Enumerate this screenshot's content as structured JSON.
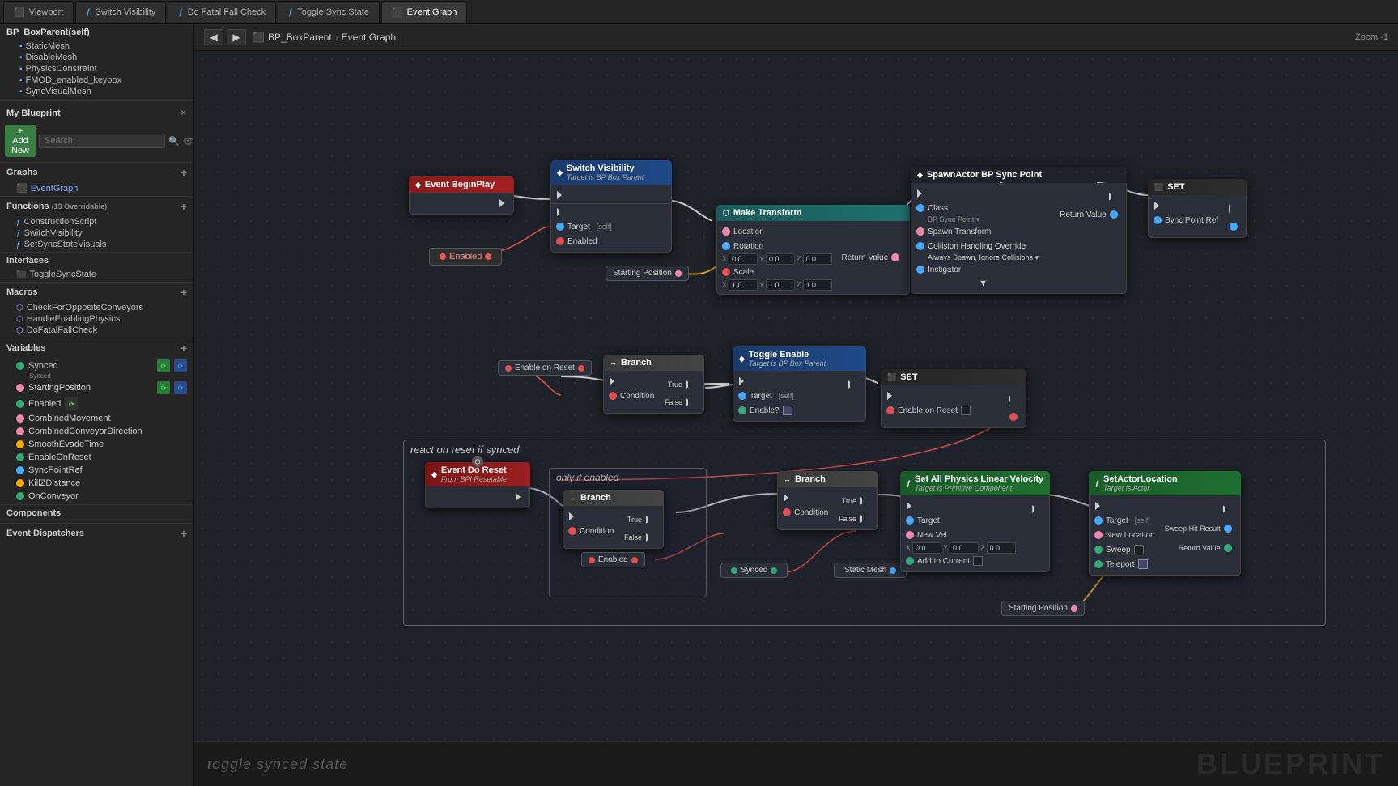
{
  "tabs": [
    {
      "label": "Viewport",
      "icon": "vp",
      "active": false,
      "color": "#4a8"
    },
    {
      "label": "Switch Visibility",
      "icon": "f",
      "active": false,
      "color": "#4af"
    },
    {
      "label": "Do Fatal Fall Check",
      "icon": "f",
      "active": false,
      "color": "#4af"
    },
    {
      "label": "Toggle Sync State",
      "icon": "f",
      "active": false,
      "color": "#4af"
    },
    {
      "label": "Event Graph",
      "icon": "eg",
      "active": true,
      "color": "#7af"
    }
  ],
  "breadcrumb": {
    "parent": "BP_BoxParent",
    "child": "Event Graph"
  },
  "zoom": "Zoom -1",
  "sidebar": {
    "header": "BP_BoxParent(self)",
    "top_items": [
      {
        "icon": "▪",
        "label": "StaticMesh"
      },
      {
        "icon": "▪",
        "label": "DisableMesh"
      },
      {
        "icon": "▪",
        "label": "PhysicsConstraint"
      },
      {
        "icon": "▪",
        "label": "FMOD_enabled_keybox"
      },
      {
        "icon": "▪",
        "label": "SyncVisualMesh"
      }
    ],
    "my_blueprint": "My Blueprint",
    "add_new": "+ Add New",
    "search_placeholder": "Search",
    "sections": {
      "graphs": {
        "label": "Graphs",
        "count": null
      },
      "graphs_items": [
        "EventGraph"
      ],
      "functions": {
        "label": "Functions",
        "count": "(19 Overridable)"
      },
      "functions_items": [
        "ConstructionScript",
        "SwitchVisibility",
        "SetSyncStateVisuals"
      ],
      "interfaces": {
        "label": "Interfaces"
      },
      "interfaces_items": [
        "ToggleSyncState"
      ],
      "macros": {
        "label": "Macros"
      },
      "macros_items": [
        "CheckForOppositeConveyors",
        "HandleEnablingPhysics",
        "DoFatalFallCheck"
      ],
      "variables": {
        "label": "Variables"
      },
      "variables_items": [
        {
          "name": "Synced",
          "color": "#3a7",
          "synced": true
        },
        {
          "name": "StartingPosition",
          "color": "#e8a",
          "synced": true
        },
        {
          "name": "Enabled",
          "color": "#3a7",
          "synced": false
        },
        {
          "name": "CombinedMovement",
          "color": "#e8a",
          "synced": false
        },
        {
          "name": "CombinedConveyorDirection",
          "color": "#e8a",
          "synced": false
        },
        {
          "name": "SmoothEvadeTime",
          "color": "#fa0",
          "synced": false
        },
        {
          "name": "EnableOnReset",
          "color": "#3a7",
          "synced": false
        },
        {
          "name": "SyncPointRef",
          "color": "#4af",
          "synced": false
        },
        {
          "name": "KillZDistance",
          "color": "#fa0",
          "synced": false
        },
        {
          "name": "OnConveyor",
          "color": "#3a7",
          "synced": false
        }
      ],
      "components": {
        "label": "Components"
      },
      "event_dispatchers": {
        "label": "Event Dispatchers"
      }
    }
  },
  "nodes": {
    "event_begin_play": "Event BeginPlay",
    "switch_visibility": "Switch Visibility",
    "switch_vis_target": "Target is BP Box Parent",
    "make_transform": "Make Transform",
    "location": "Location",
    "rotation": "Rotation",
    "scale": "Scale",
    "return_value": "Return Value",
    "spawn_actor": "SpawnActor BP Sync Point",
    "class": "Class",
    "spawn_transform": "Spawn Transform",
    "collision_handling": "Collision Handling Override",
    "always_spawn": "Always Spawn, Ignore Collisions ▾",
    "instigator": "Instigator",
    "set": "SET",
    "sync_point_ref": "Sync Point Ref",
    "enabled_label": "Enabled",
    "starting_position": "Starting Position",
    "enable_on_reset": "Enable on Reset",
    "branch": "Branch",
    "condition": "Condition",
    "true_label": "True",
    "false_label": "False",
    "toggle_enable": "Toggle Enable",
    "toggle_enable_target": "Target is BP Box Parent",
    "target_self": "self",
    "enable_question": "Enable?",
    "set2": "SET",
    "enable_on_reset2": "Enable on Reset",
    "comment1": "react on reset if synced",
    "comment2": "only if enabled",
    "event_do_reset": "Event Do Reset",
    "from_bpi": "From BPI Resetable",
    "branch2": "Branch",
    "condition2": "Condition",
    "true2": "True",
    "false2": "False",
    "enabled2": "Enabled",
    "branch3": "Branch",
    "condition3": "Condition",
    "true3": "True",
    "false3": "False",
    "synced_node": "Synced",
    "static_mesh": "Static Mesh",
    "set_physics": "Set All Physics Linear Velocity",
    "physics_target": "Target is Primitive Component",
    "new_vel": "New Vel",
    "add_to_current": "Add to Current",
    "set_actor_location": "SetActorLocation",
    "actor_target": "Target is Actor",
    "target2": "Target",
    "sweep_hit": "Sweep Hit Result",
    "new_location": "New Location",
    "sweep": "Sweep",
    "teleport": "Teleport",
    "return_value2": "Return Value",
    "starting_position2": "Starting Position",
    "bottom_label": "toggle synced state",
    "blueprint_watermark": "BLUEPRINT"
  },
  "colors": {
    "exec_white": "#cccccc",
    "pin_red": "#e05050",
    "pin_blue": "#5090e0",
    "pin_green": "#50e050",
    "pin_orange": "#e08030",
    "pin_yellow": "#e0e050",
    "pin_purple": "#a050e0",
    "pin_teal": "#50d0d0",
    "header_event": "#8B1A1A",
    "header_func": "#1a3a8a",
    "header_spawn": "#1a5a6a",
    "header_set": "#2e2e2e",
    "header_branch": "#3a3a3a",
    "header_toggle": "#1a3a8a",
    "wire_white": "#aaaaaa",
    "wire_red": "#e05050",
    "wire_yellow": "#d4c040",
    "wire_orange": "#d08030"
  }
}
